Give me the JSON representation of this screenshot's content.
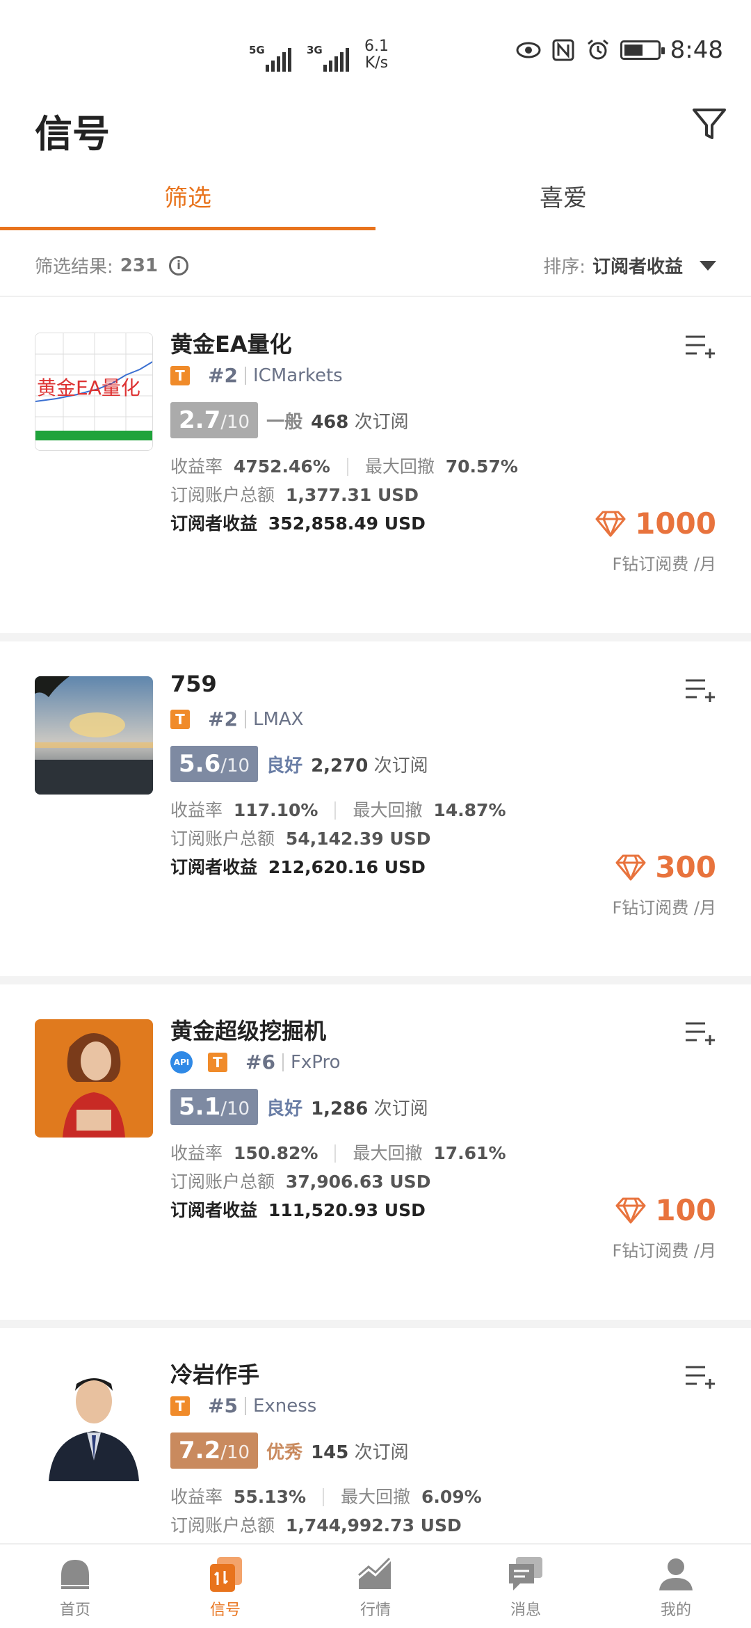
{
  "status_bar": {
    "net1": "5G",
    "net2": "3G",
    "speed_value": "6.1",
    "speed_unit": "K/s",
    "time": "8:48"
  },
  "header": {
    "title": "信号"
  },
  "tabs": [
    {
      "label": "筛选",
      "active": true
    },
    {
      "label": "喜爱",
      "active": false
    }
  ],
  "results": {
    "label": "筛选结果:",
    "count": "231",
    "sort_label": "排序:",
    "sort_value": "订阅者收益"
  },
  "stat_labels": {
    "return_rate": "收益率",
    "max_drawdown": "最大回撤",
    "account_total": "订阅账户总额",
    "subscriber_profit": "订阅者收益",
    "fee_unit": "F钻订阅费 /月",
    "subs_suffix": "次订阅"
  },
  "signals": [
    {
      "title": "黄金EA量化",
      "api": false,
      "rank": "#2",
      "broker": "ICMarkets",
      "score": "2.7",
      "score_max": "/10",
      "rating": "一般",
      "score_color": "#ababab",
      "rating_color": "#888888",
      "subs": "468",
      "return_rate": "4752.46%",
      "max_drawdown": "70.57%",
      "account_total": "1,377.31 USD",
      "subscriber_profit": "352,858.49 USD",
      "price": "1000",
      "thumb_text": "黄金EA量化"
    },
    {
      "title": "759",
      "api": false,
      "rank": "#2",
      "broker": "LMAX",
      "score": "5.6",
      "score_max": "/10",
      "rating": "良好",
      "score_color": "#7e8aa2",
      "rating_color": "#6a7ea6",
      "subs": "2,270",
      "return_rate": "117.10%",
      "max_drawdown": "14.87%",
      "account_total": "54,142.39 USD",
      "subscriber_profit": "212,620.16 USD",
      "price": "300"
    },
    {
      "title": "黄金超级挖掘机",
      "api": true,
      "api_label": "API",
      "rank": "#6",
      "broker": "FxPro",
      "score": "5.1",
      "score_max": "/10",
      "rating": "良好",
      "score_color": "#7e8aa2",
      "rating_color": "#6a7ea6",
      "subs": "1,286",
      "return_rate": "150.82%",
      "max_drawdown": "17.61%",
      "account_total": "37,906.63 USD",
      "subscriber_profit": "111,520.93 USD",
      "price": "100"
    },
    {
      "title": "冷岩作手",
      "api": false,
      "rank": "#5",
      "broker": "Exness",
      "score": "7.2",
      "score_max": "/10",
      "rating": "优秀",
      "score_color": "#c98a5e",
      "rating_color": "#c98a5e",
      "subs": "145",
      "return_rate": "55.13%",
      "max_drawdown": "6.09%",
      "account_total": "1,744,992.73 USD"
    }
  ],
  "bottom_nav": [
    {
      "label": "首页",
      "icon": "home-icon",
      "active": false
    },
    {
      "label": "信号",
      "icon": "signal-icon",
      "active": true
    },
    {
      "label": "行情",
      "icon": "chart-icon",
      "active": false
    },
    {
      "label": "消息",
      "icon": "message-icon",
      "active": false
    },
    {
      "label": "我的",
      "icon": "profile-icon",
      "active": false
    }
  ],
  "colors": {
    "accent": "#e8731c",
    "price": "#e8733d",
    "t_badge": "#f08b2a",
    "api_badge": "#2f89e6"
  }
}
